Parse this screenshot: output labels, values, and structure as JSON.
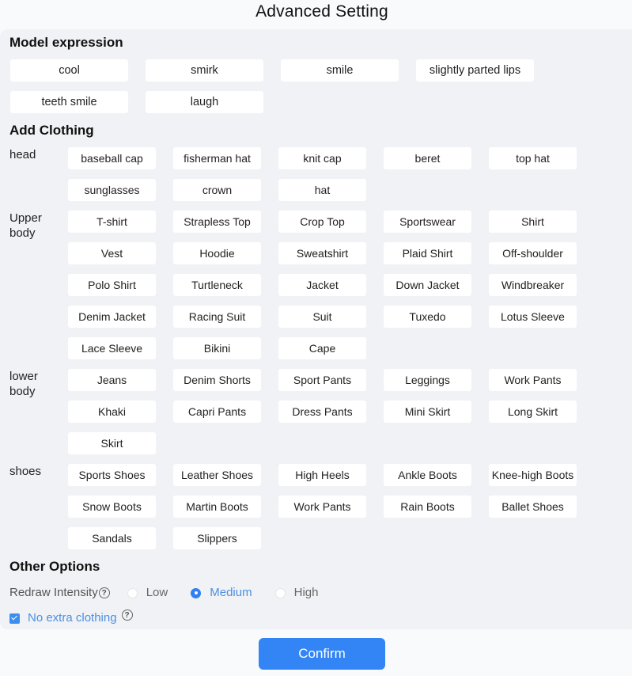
{
  "title": "Advanced Setting",
  "expression": {
    "heading": "Model expression",
    "options": [
      "cool",
      "smirk",
      "smile",
      "slightly parted lips",
      "teeth smile",
      "laugh"
    ]
  },
  "clothing": {
    "heading": "Add Clothing",
    "categories": [
      {
        "label": "head",
        "items": [
          "baseball cap",
          "fisherman hat",
          "knit cap",
          "beret",
          "top hat",
          "sunglasses",
          "crown",
          "hat"
        ]
      },
      {
        "label": "Upper body",
        "items": [
          "T-shirt",
          "Strapless Top",
          "Crop Top",
          "Sportswear",
          "Shirt",
          "Vest",
          "Hoodie",
          "Sweatshirt",
          "Plaid Shirt",
          "Off-shoulder",
          "Polo Shirt",
          "Turtleneck",
          "Jacket",
          "Down Jacket",
          "Windbreaker",
          "Denim Jacket",
          "Racing Suit",
          "Suit",
          "Tuxedo",
          "Lotus Sleeve",
          "Lace Sleeve",
          "Bikini",
          "Cape"
        ]
      },
      {
        "label": "lower body",
        "items": [
          "Jeans",
          "Denim Shorts",
          "Sport Pants",
          "Leggings",
          "Work Pants",
          "Khaki",
          "Capri Pants",
          "Dress Pants",
          "Mini Skirt",
          "Long Skirt",
          "Skirt"
        ]
      },
      {
        "label": "shoes",
        "items": [
          "Sports Shoes",
          "Leather Shoes",
          "High Heels",
          "Ankle Boots",
          "Knee-high Boots",
          "Snow Boots",
          "Martin Boots",
          "Work Pants",
          "Rain Boots",
          "Ballet Shoes",
          "Sandals",
          "Slippers"
        ]
      }
    ]
  },
  "other": {
    "heading": "Other Options",
    "redraw_label": "Redraw Intensity",
    "help_glyph": "?",
    "redraw_options": [
      "Low",
      "Medium",
      "High"
    ],
    "redraw_selected": "Medium",
    "no_extra_label": "No extra clothing",
    "no_extra_checked": true
  },
  "confirm_label": "Confirm",
  "colors": {
    "accent": "#3385f5",
    "panel_bg": "#f1f2f5",
    "chip_bg": "#ffffff"
  }
}
